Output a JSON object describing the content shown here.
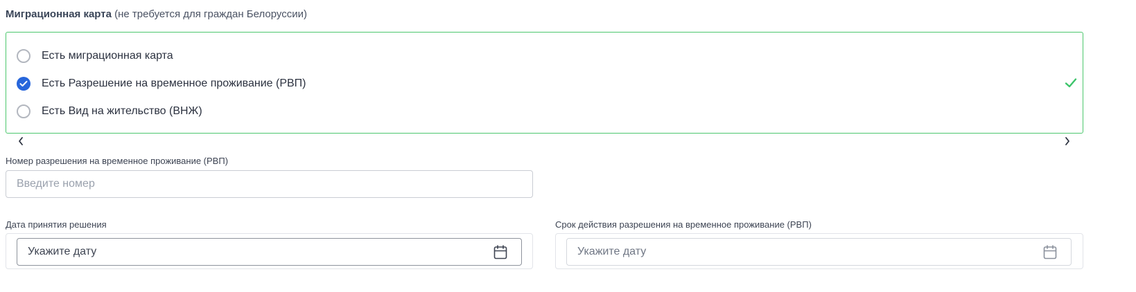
{
  "section": {
    "title_strong": "Миграционная карта",
    "title_note": "(не требуется для граждан Белоруссии)"
  },
  "radio_group": {
    "options": [
      {
        "label": "Есть миграционная карта",
        "checked": false
      },
      {
        "label": "Есть Разрешение на временное проживание (РВП)",
        "checked": true
      },
      {
        "label": "Есть Вид на жительство (ВНЖ)",
        "checked": false
      }
    ],
    "status": "valid"
  },
  "permit_number": {
    "label": "Номер разрешения на временное проживание (РВП)",
    "placeholder": "Введите номер",
    "value": ""
  },
  "decision_date": {
    "label": "Дата принятия решения",
    "placeholder": "Укажите дату"
  },
  "permit_validity": {
    "label": "Срок действия разрешения на временное проживание (РВП)",
    "placeholder": "Укажите дату"
  },
  "icons": {
    "calendar": "calendar-icon",
    "check": "check-icon",
    "chevron_left": "chevron-left-icon",
    "chevron_right": "chevron-right-icon"
  },
  "colors": {
    "accent": "#2766db",
    "success": "#4cc76d"
  }
}
